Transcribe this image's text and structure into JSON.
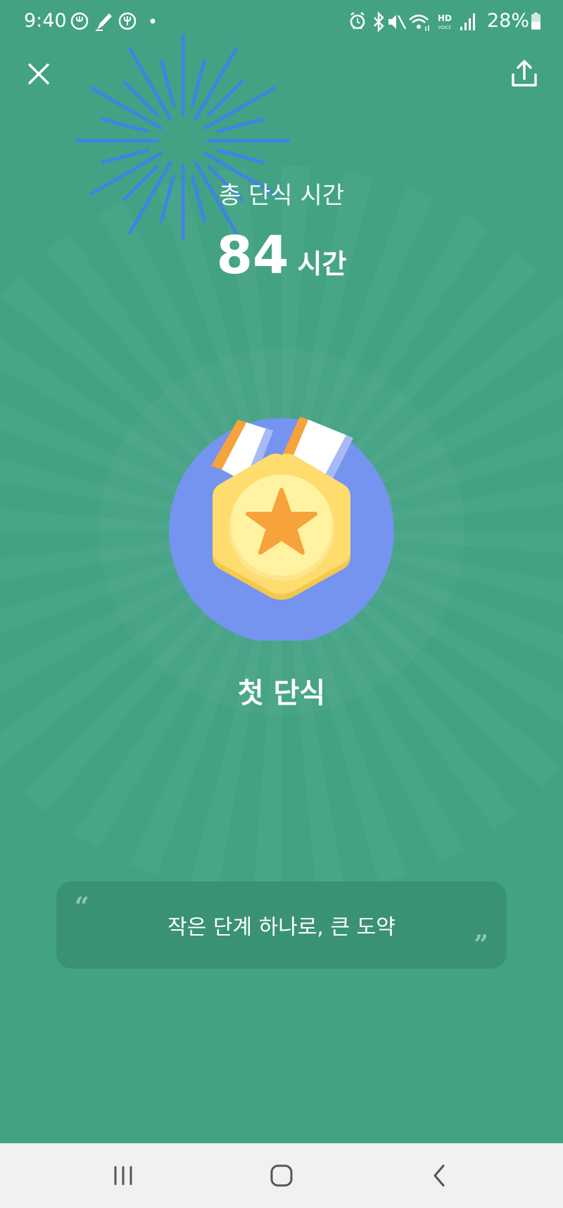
{
  "status_bar": {
    "time": "9:40",
    "battery_percent": "28%",
    "left_icons": [
      "fasting-app-icon",
      "pen-icon",
      "fasting-app-icon",
      "notification-dot-icon"
    ],
    "right_icons": [
      "alarm-icon",
      "bluetooth-icon",
      "mute-icon",
      "wifi-icon",
      "hd-voice-icon",
      "signal-icon",
      "battery-icon"
    ],
    "hd_label": "HD",
    "voice_label": "VOICE"
  },
  "header": {
    "close_icon": "close-icon",
    "share_icon": "share-icon"
  },
  "summary": {
    "label": "총 단식 시간",
    "value": "84",
    "unit": "시간"
  },
  "badge": {
    "icon": "medal-star-icon",
    "title": "첫 단식"
  },
  "quote": {
    "open_mark": "“",
    "text": "작은 단계 하나로, 큰 도약",
    "close_mark": "”"
  },
  "navigation": {
    "recents_icon": "recents-icon",
    "home_icon": "home-icon",
    "back_icon": "back-icon"
  },
  "colors": {
    "background": "#43a283",
    "quote_card": "#3a9275",
    "medal_circle": "#7494f0",
    "medal_gold": "#ffdc6e",
    "star": "#f6a33b",
    "firework": "#3f84e4",
    "nav_bar": "#f1f1f1"
  }
}
